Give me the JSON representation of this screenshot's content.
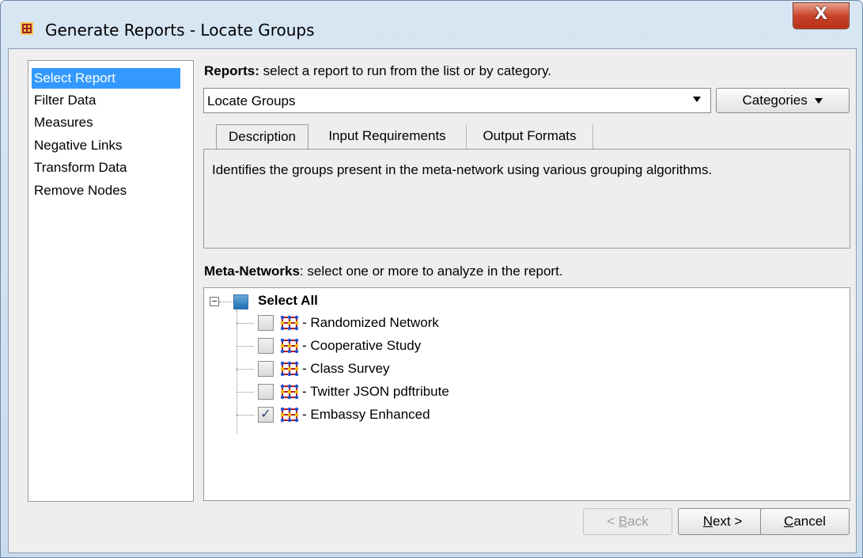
{
  "window": {
    "title": "Generate Reports - Locate Groups",
    "close_label": "X"
  },
  "nav": {
    "items": [
      {
        "label": "Select Report",
        "selected": true
      },
      {
        "label": "Filter Data"
      },
      {
        "label": "Measures"
      },
      {
        "label": "Negative Links"
      },
      {
        "label": "Transform Data"
      },
      {
        "label": "Remove Nodes"
      }
    ]
  },
  "reports": {
    "heading_bold": "Reports:",
    "heading_rest": " select a report to run from the list or by category.",
    "selected_report": "Locate Groups",
    "categories_label": "Categories"
  },
  "tabs": [
    {
      "label": "Description",
      "active": true
    },
    {
      "label": "Input Requirements"
    },
    {
      "label": "Output Formats"
    }
  ],
  "description_text": "Identifies the groups present in the meta-network using various grouping algorithms.",
  "meta_networks": {
    "heading_bold": "Meta-Networks",
    "heading_rest": ": select one or more to analyze in the report.",
    "select_all_label": "Select All",
    "items": [
      {
        "label": "- Randomized Network",
        "checked": false
      },
      {
        "label": "- Cooperative Study",
        "checked": false
      },
      {
        "label": "- Class Survey",
        "checked": false
      },
      {
        "label": "- Twitter JSON pdftribute",
        "checked": false
      },
      {
        "label": "- Embassy Enhanced",
        "checked": true
      }
    ]
  },
  "footer": {
    "back_mnemonic": "B",
    "back_rest": "ack",
    "back_prefix": "< ",
    "next_mnemonic": "N",
    "next_rest": "ext >",
    "cancel_mnemonic": "C",
    "cancel_rest": "ancel"
  },
  "colors": {
    "selection": "#3399ff",
    "titlebar": "#c9dcee",
    "close": "#c9432a"
  }
}
